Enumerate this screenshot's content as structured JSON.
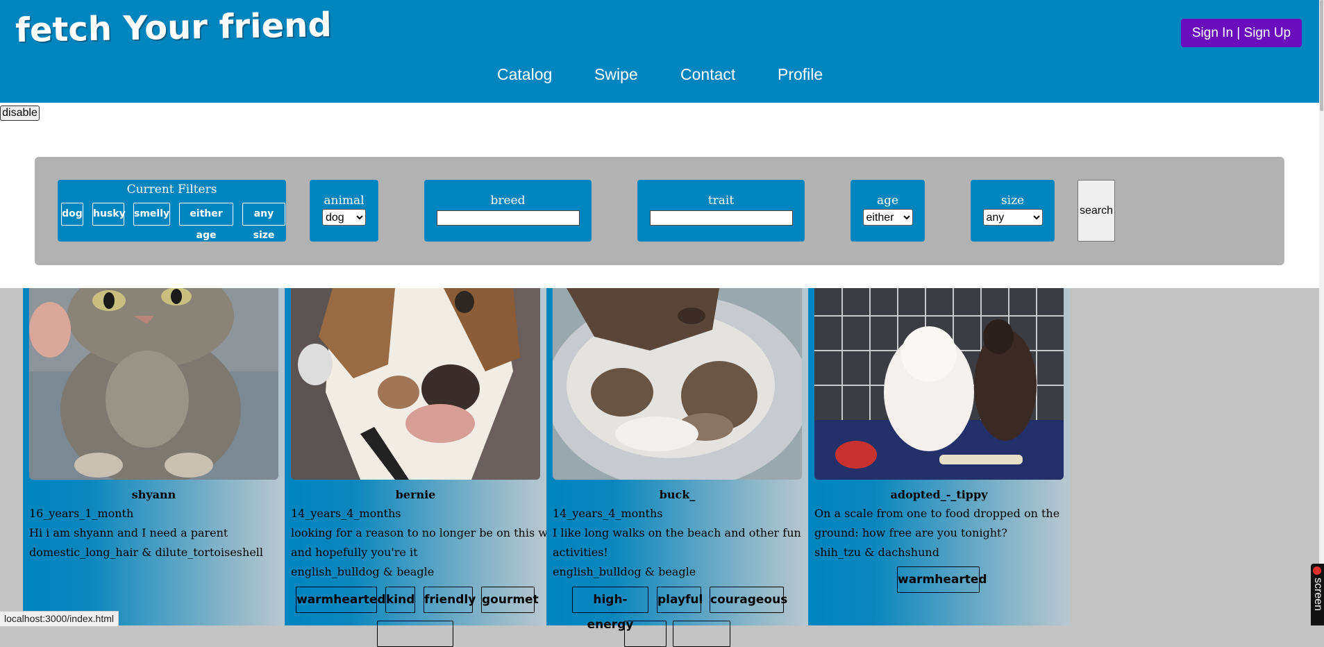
{
  "header": {
    "logo": "fetch Your friend",
    "signin_label": "Sign In | Sign Up",
    "nav": [
      "Catalog",
      "Swipe",
      "Contact",
      "Profile"
    ]
  },
  "disable_label": "disable",
  "filters": {
    "current_title": "Current Filters",
    "current": [
      "dog",
      "husky",
      "smelly",
      "either age",
      "any size"
    ],
    "animal": {
      "label": "animal",
      "value": "dog"
    },
    "breed": {
      "label": "breed",
      "value": ""
    },
    "trait": {
      "label": "trait",
      "value": ""
    },
    "age": {
      "label": "age",
      "value": "either"
    },
    "size": {
      "label": "size",
      "value": "any"
    },
    "search_label": "search"
  },
  "cards": [
    {
      "name": "shyann",
      "age": "16_years_1_month",
      "bio": [
        "Hi i am shyann and I need a parent"
      ],
      "breed": "domestic_long_hair & dilute_tortoiseshell",
      "tags": []
    },
    {
      "name": "bernie",
      "age": "14_years_4_months",
      "bio": [
        "looking for a reason to no longer be on this website",
        "and hopefully you're it"
      ],
      "breed": "english_bulldog & beagle",
      "tags": [
        "warmhearted",
        "kind",
        "friendly",
        "gourmet"
      ]
    },
    {
      "name": "buck_",
      "age": "14_years_4_months",
      "bio": [
        "I like long walks on the beach and other fun",
        "activities!"
      ],
      "breed": "english_bulldog & beagle",
      "tags": [
        "high-energy",
        "playful",
        "courageous"
      ]
    },
    {
      "name": "adopted_-_tippy",
      "age": "",
      "bio": [
        "On a scale from one to food dropped on the",
        "ground: how free are you tonight?"
      ],
      "breed": "shih_tzu & dachshund",
      "tags": [
        "warmhearted"
      ]
    }
  ],
  "status_url": "localhost:3000/index.html",
  "recorder_label": "screen"
}
